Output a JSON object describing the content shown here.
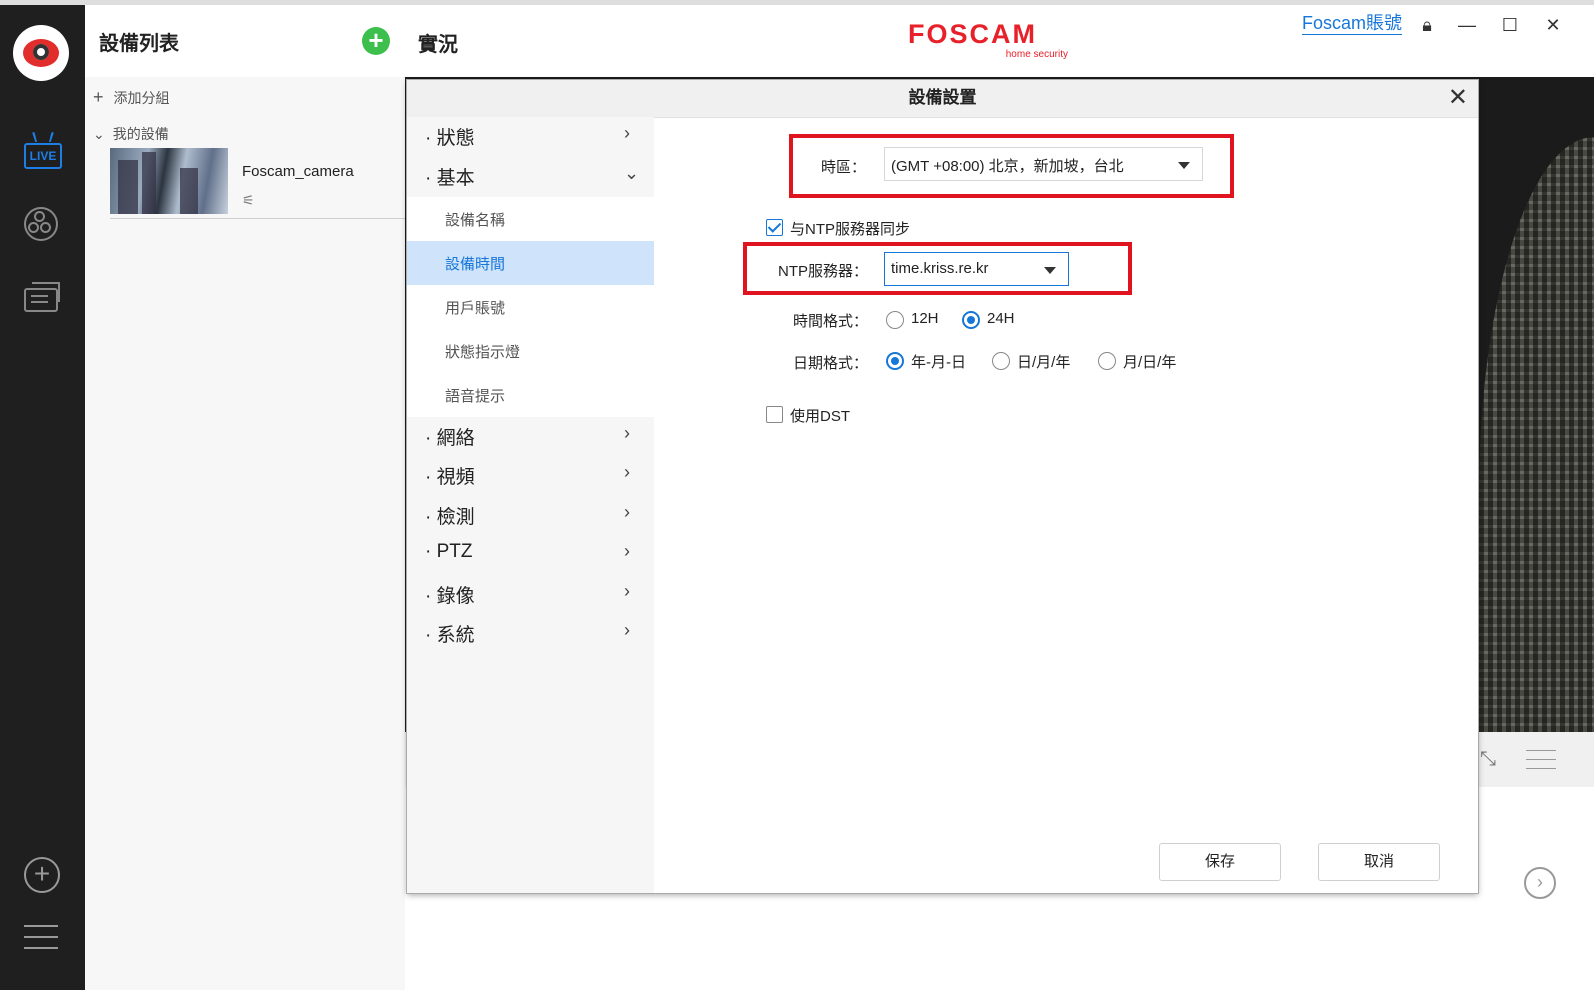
{
  "device_panel": {
    "title": "設備列表",
    "add_group": "添加分組",
    "my_devices": "我的設備",
    "device_name": "Foscam_camera"
  },
  "main": {
    "title": "實況",
    "brand": "FOSCAM",
    "brand_tagline": "home security",
    "account_link": "Foscam賬號"
  },
  "dialog": {
    "title": "設備設置",
    "nav": [
      {
        "label": "狀態",
        "arrow": "›"
      },
      {
        "label": "基本",
        "arrow": "⌄"
      },
      {
        "label": "網絡",
        "arrow": "›"
      },
      {
        "label": "視頻",
        "arrow": "›"
      },
      {
        "label": "檢測",
        "arrow": "›"
      },
      {
        "label": "PTZ",
        "arrow": "›"
      },
      {
        "label": "錄像",
        "arrow": "›"
      },
      {
        "label": "系統",
        "arrow": "›"
      }
    ],
    "subnav": [
      "設備名稱",
      "設備時間",
      "用戶賬號",
      "狀態指示燈",
      "語音提示"
    ],
    "active_subnav": "設備時間",
    "timezone_label": "時區：",
    "timezone_value": "(GMT +08:00) 北京，新加坡，台北",
    "ntp_sync_label": "与NTP服務器同步",
    "ntp_sync_checked": true,
    "ntp_server_label": "NTP服務器：",
    "ntp_server_value": "time.kriss.re.kr",
    "time_format_label": "時間格式：",
    "time_format_options": [
      "12H",
      "24H"
    ],
    "time_format_selected": "24H",
    "date_format_label": "日期格式：",
    "date_format_options": [
      "年-月-日",
      "日/月/年",
      "月/日/年"
    ],
    "date_format_selected": "年-月-日",
    "dst_label": "使用DST",
    "dst_checked": false,
    "save_label": "保存",
    "cancel_label": "取消"
  },
  "colors": {
    "accent": "#1677d8",
    "highlight_box": "#e0141e",
    "brand": "#e8202a",
    "add_button": "#3cbf4c"
  }
}
